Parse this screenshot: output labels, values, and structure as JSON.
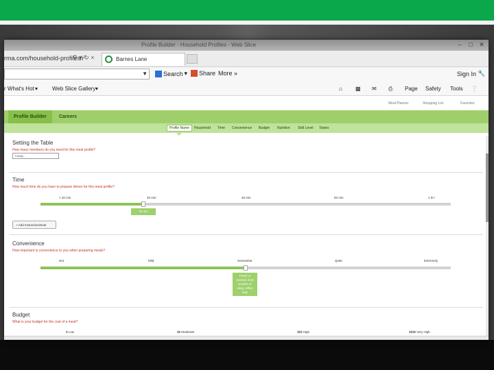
{
  "browser": {
    "url": "rma.com/household-profiles/r",
    "window_title_blurred": "Profile Builder - Household Profiles - Web Slice",
    "tab_label": "Barnes Lane",
    "toolbar": {
      "search_label": "Search",
      "share_label": "Share",
      "more_label": "More »",
      "signin_label": "Sign In",
      "whats_hot_label": "r What's Hot",
      "web_slice_label": "Web Slice Gallery",
      "page_label": "Page",
      "safety_label": "Safety",
      "tools_label": "Tools"
    }
  },
  "site": {
    "top_links": [
      "Meal Planner",
      "Shopping List",
      "Favorites"
    ],
    "main_tabs": [
      "Profile Builder",
      "Careers"
    ],
    "sub_tabs": [
      "Profile Name",
      "Household",
      "Time",
      "Convenience",
      "Budget",
      "Nutrition",
      "Skill Level",
      "Tastes"
    ],
    "setting": {
      "title": "Setting the Table",
      "question": "How many members do you need for this meal profile?",
      "select_placeholder": "Family..."
    },
    "time": {
      "title": "Time",
      "question": "How much time do you have to prepare dinner for this meal profile?",
      "labels": [
        "< 20 min",
        "30 min",
        "45 min",
        "60 min",
        "1 hr+"
      ],
      "value_fraction": 0.25,
      "bubble": "30 min",
      "add_button": "+ Add Instruction/Note"
    },
    "convenience": {
      "title": "Convenience",
      "question": "How important is convenience to you when preparing meals?",
      "labels": [
        "Not",
        "Mild",
        "Somewhat",
        "Quite",
        "Extremely"
      ],
      "value_fraction": 0.5,
      "bubble": "Fresh or canned, from scratch or easy, either way"
    },
    "budget": {
      "title": "Budget",
      "question": "What is your budget for the cost of a meal?",
      "labels": [
        "$ Low",
        "$$ Moderate",
        "$$$ High",
        "$$$$ Very High"
      ]
    }
  },
  "colors": {
    "slide_green": "#0aa74b",
    "nav_green": "#9fcf6a",
    "question_red": "#c0392b"
  }
}
